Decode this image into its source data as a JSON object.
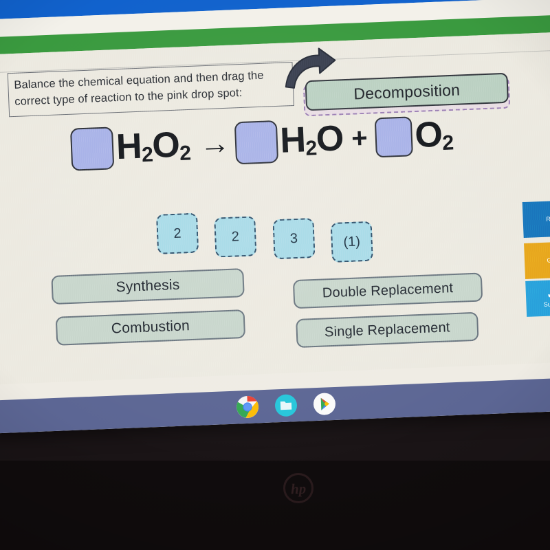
{
  "browser": {
    "heart_icon": "heart-icon",
    "bar_blue": "#1162cd",
    "bar_green": "#3a9a3f"
  },
  "quiz": {
    "prompt": "Balance the chemical equation and then drag the correct type of reaction to the pink drop spot:",
    "drop_spot_label": "pink drop spot",
    "placed_answer": "Decomposition",
    "drag_arrow_icon": "curved-arrow-icon",
    "cursor_icon": "mouse-pointer-icon"
  },
  "equation": {
    "terms": [
      {
        "blank": true,
        "formula": "H",
        "sub1": "2",
        "el2": "O",
        "sub2": "2"
      },
      {
        "blank": true,
        "formula": "H",
        "sub1": "2",
        "el2": "O",
        "sub2": ""
      },
      {
        "blank": true,
        "formula": "",
        "sub1": "",
        "el2": "O",
        "sub2": "2"
      }
    ],
    "reactant_1": "H",
    "reactant_1_sub": "2",
    "reactant_1_el2": "O",
    "reactant_1_sub2": "2",
    "arrow": "→",
    "product_1": "H",
    "product_1_sub": "2",
    "product_1_el2": "O",
    "plus": "+",
    "product_2": "O",
    "product_2_sub": "2"
  },
  "number_tiles": [
    {
      "label": "2"
    },
    {
      "label": "2"
    },
    {
      "label": "3"
    },
    {
      "label": "(1)"
    }
  ],
  "reaction_options": [
    {
      "label": "Synthesis"
    },
    {
      "label": "Combustion"
    },
    {
      "label": "Double Replacement"
    },
    {
      "label": "Single Replacement"
    }
  ],
  "action_rail": [
    {
      "label": "R",
      "color": "#1878bd",
      "icon": ""
    },
    {
      "label": "Gi",
      "color": "#e8a81c",
      "icon": ""
    },
    {
      "label": "Subm",
      "color": "#29a3dc",
      "icon": "✔"
    }
  ],
  "shelf": {
    "icons": [
      {
        "name": "chrome-icon"
      },
      {
        "name": "files-icon"
      },
      {
        "name": "play-store-icon"
      }
    ]
  },
  "device": {
    "brand": "hp"
  }
}
